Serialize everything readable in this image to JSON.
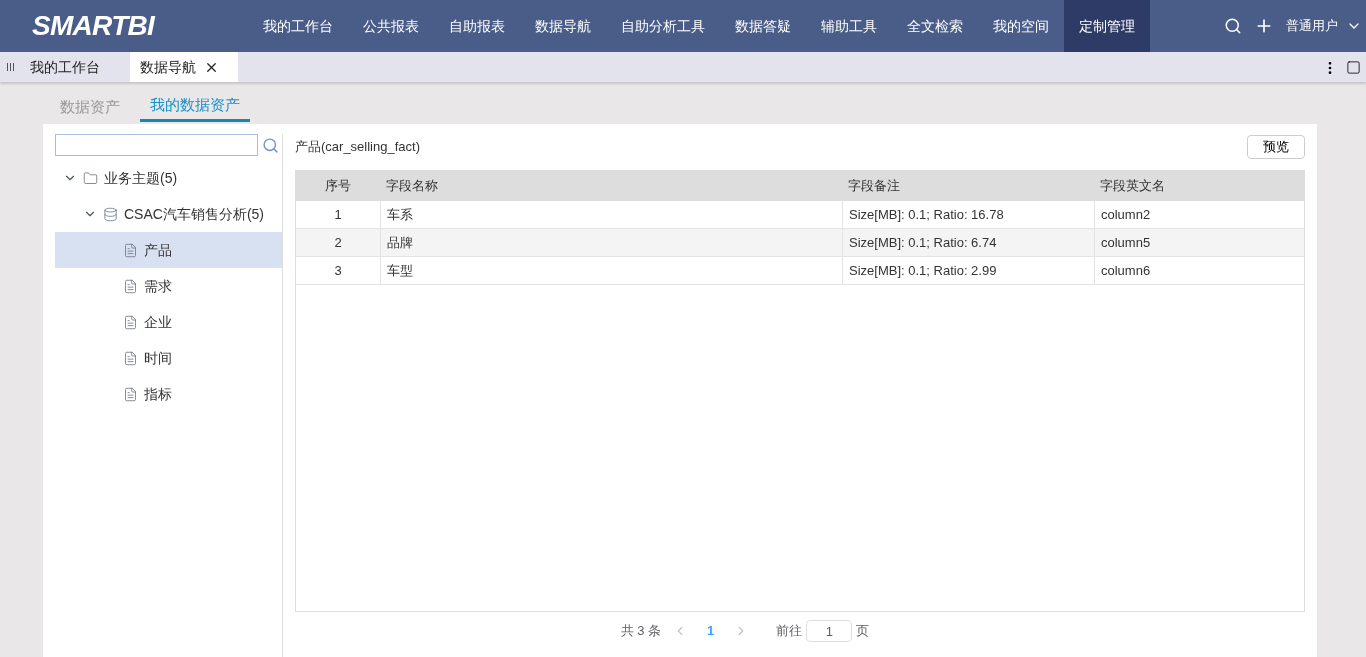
{
  "logo": "SMARTBI",
  "nav": [
    {
      "label": "我的工作台",
      "selected": false
    },
    {
      "label": "公共报表",
      "selected": false
    },
    {
      "label": "自助报表",
      "selected": false
    },
    {
      "label": "数据导航",
      "selected": false
    },
    {
      "label": "自助分析工具",
      "selected": false
    },
    {
      "label": "数据答疑",
      "selected": false
    },
    {
      "label": "辅助工具",
      "selected": false
    },
    {
      "label": "全文检索",
      "selected": false
    },
    {
      "label": "我的空间",
      "selected": false
    },
    {
      "label": "定制管理",
      "selected": true
    }
  ],
  "user": "普通用户",
  "page_tabs": [
    {
      "label": "我的工作台",
      "selected": false,
      "closable": false
    },
    {
      "label": "数据导航",
      "selected": true,
      "closable": true
    }
  ],
  "sub_tabs": [
    {
      "label": "数据资产",
      "selected": false
    },
    {
      "label": "我的数据资产",
      "selected": true
    }
  ],
  "tree": [
    {
      "label": "业务主题(5)",
      "kind": "folder",
      "expanded": true,
      "selected": false,
      "children": [
        {
          "label": "CSAC汽车销售分析(5)",
          "kind": "model",
          "expanded": true,
          "selected": false,
          "children": [
            {
              "label": "产品",
              "kind": "table",
              "selected": true
            },
            {
              "label": "需求",
              "kind": "table",
              "selected": false
            },
            {
              "label": "企业",
              "kind": "table",
              "selected": false
            },
            {
              "label": "时间",
              "kind": "table",
              "selected": false
            },
            {
              "label": "指标",
              "kind": "table",
              "selected": false
            }
          ]
        }
      ]
    }
  ],
  "detail_title": "产品(car_selling_fact)",
  "preview_button": "预览",
  "table": {
    "columns": [
      "序号",
      "字段名称",
      "字段备注",
      "字段英文名"
    ],
    "rows": [
      [
        "1",
        "车系",
        "Size[MB]: 0.1; Ratio: 16.78",
        "column2"
      ],
      [
        "2",
        "品牌",
        "Size[MB]: 0.1; Ratio: 6.74",
        "column5"
      ],
      [
        "3",
        "车型",
        "Size[MB]: 0.1; Ratio: 2.99",
        "column6"
      ]
    ]
  },
  "pagination": {
    "total": "共 3 条",
    "pages": [
      {
        "label": "1",
        "selected": true
      }
    ],
    "goto_label": "前往",
    "goto_value": "1",
    "page_suffix": "页"
  }
}
